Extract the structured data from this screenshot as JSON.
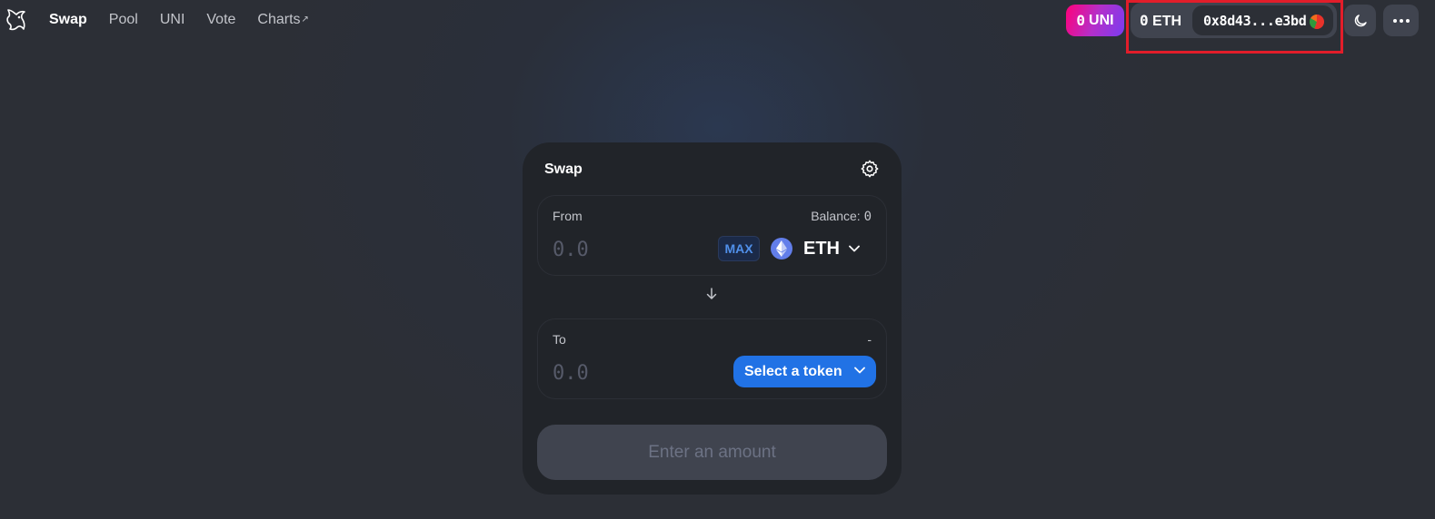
{
  "nav": {
    "items": [
      {
        "label": "Swap",
        "active": true
      },
      {
        "label": "Pool"
      },
      {
        "label": "UNI"
      },
      {
        "label": "Vote"
      },
      {
        "label": "Charts",
        "external_marker": "↗"
      }
    ]
  },
  "header": {
    "uni_balance": {
      "amount": "0",
      "symbol": "UNI"
    },
    "eth_balance": {
      "amount": "0",
      "symbol": "ETH"
    },
    "address": "0x8d43...e3bd",
    "icons": [
      "logo-icon",
      "moon-icon",
      "more-icon"
    ],
    "colors": {
      "highlight": "#e21d2a",
      "uni_gradient_start": "#ff007a",
      "uni_gradient_end": "#7a3cf0"
    }
  },
  "swap": {
    "title": "Swap",
    "from": {
      "label": "From",
      "balance_label": "Balance:",
      "balance_value": "0",
      "amount_placeholder": "0.0",
      "max_label": "MAX",
      "token": "ETH"
    },
    "to": {
      "label": "To",
      "right_label": "-",
      "amount_placeholder": "0.0",
      "select_label": "Select a token"
    },
    "action_label": "Enter an amount",
    "colors": {
      "primary": "#2172e5",
      "card": "#212429",
      "disabled_text": "#6c7284"
    }
  }
}
